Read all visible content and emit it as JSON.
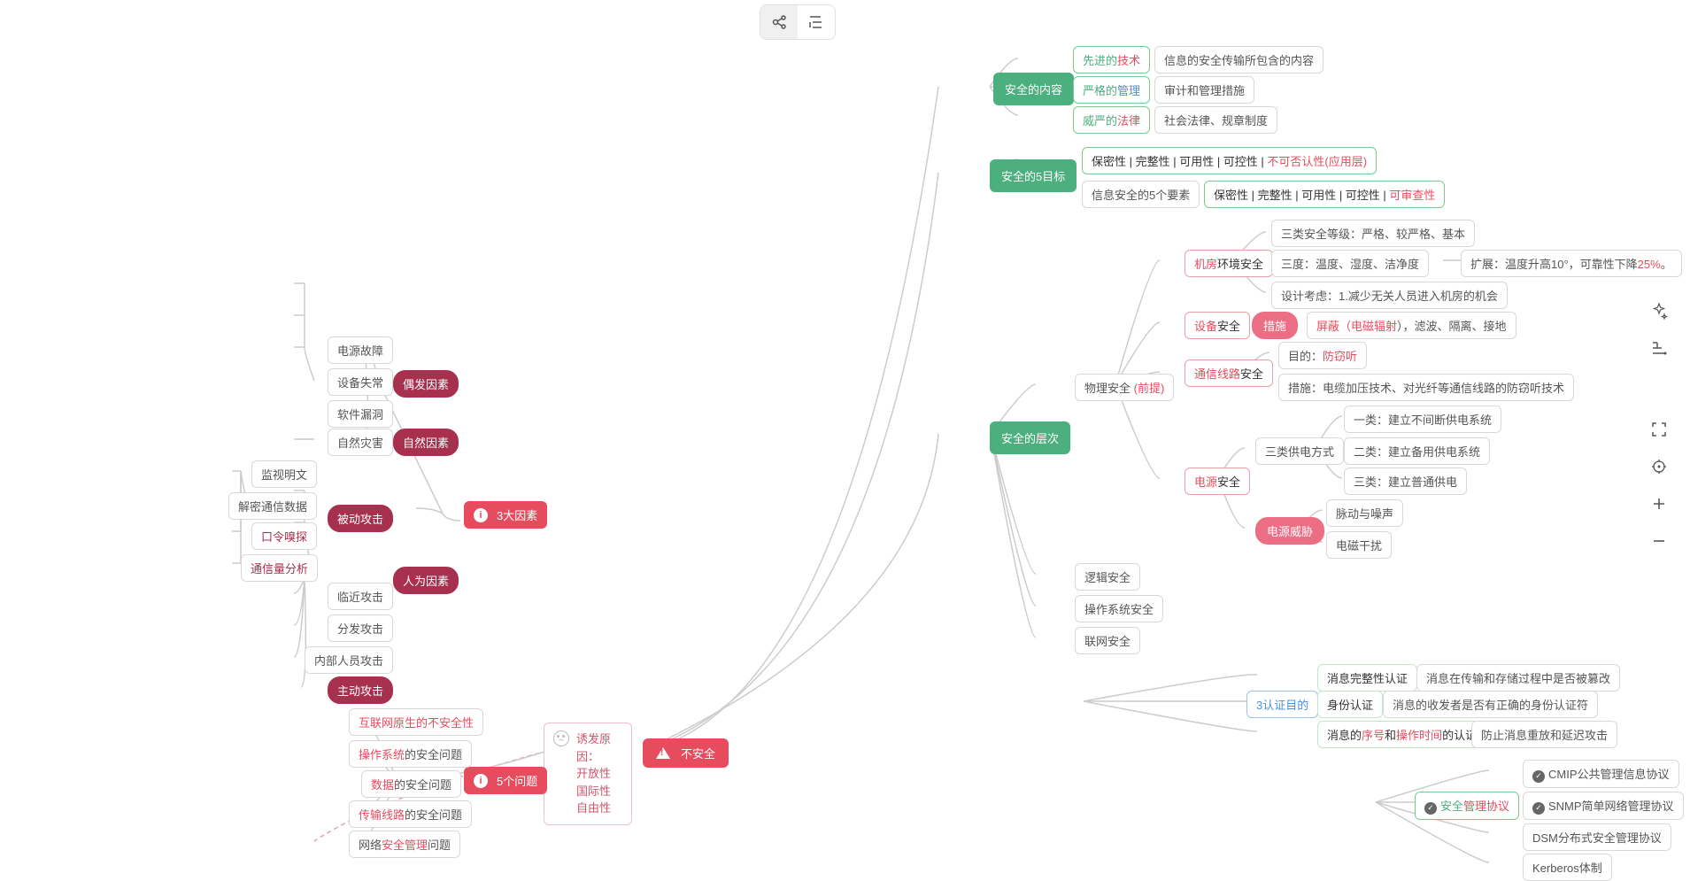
{
  "toolbar": {
    "mindmap_icon": "mindmap-view-icon",
    "outline_icon": "outline-view-icon"
  },
  "right_tools": {
    "magic": "magic-icon",
    "layout": "layout-icon",
    "fit": "fit-view-icon",
    "center": "center-view-icon",
    "zoom_in": "zoom-in-icon",
    "zoom_out": "zoom-out-icon"
  },
  "center": {
    "unsafe": "不安全",
    "cause_box": {
      "title": "诱发原因：",
      "l1": "开放性",
      "l2": "国际性",
      "l3": "自由性"
    }
  },
  "factors3": "3大因素",
  "problems5": "5个问题",
  "accidental": "偶发因素",
  "natural_factor": "自然因素",
  "human_factor": "人为因素",
  "passive_attack": "被动攻击",
  "active_attack": "主动攻击",
  "acc": {
    "power": "电源故障",
    "device": "设备失常",
    "software": "软件漏洞"
  },
  "nat": {
    "disaster": "自然灾害"
  },
  "passive": {
    "monitor": "监视明文",
    "decrypt": "解密通信数据",
    "password": "口令嗅探",
    "traffic": "通信量分析"
  },
  "human": {
    "near": "临近攻击",
    "dist": "分发攻击",
    "internal": "内部人员攻击"
  },
  "problems": {
    "p1a": "互联网原生的",
    "p1b": "不安全性",
    "p2a": "操作系统",
    "p2b": "的安全问题",
    "p3a": "数据",
    "p3b": "的安全问题",
    "p4a": "传输线路",
    "p4b": "的安全问题",
    "p5a": "网络",
    "p5b": "安全管理",
    "p5c": "问题"
  },
  "sec_content": {
    "title": "安全的内容",
    "adv_tech_a": "先进的",
    "adv_tech_b": "技术",
    "adv_tech_desc": "信息的安全传输所包含的内容",
    "strict_mgmt_a": "严格的",
    "strict_mgmt_b": "管理",
    "strict_mgmt_desc": "审计和管理措施",
    "law_a": "威严的",
    "law_b": "法律",
    "law_desc": "社会法律、规章制度"
  },
  "five_targets": {
    "title_a": "安全的",
    "title_b": "5目标",
    "row1": "保密性 | 完整性 | 可用性 | 可控性 | ",
    "row1_red": "不可否认性(应用层)",
    "row2_label": "信息安全的5个要素",
    "row2": "保密性 | 完整性 | 可用性 | 可控性 | ",
    "row2_red": "可审查性"
  },
  "layers": {
    "title": "安全的层次",
    "physical_a": "物理安全 ",
    "physical_b": "(前提)",
    "logical": "逻辑安全",
    "os": "操作系统安全",
    "net": "联网安全"
  },
  "room": {
    "title_a": "机房",
    "title_b": "环境安全",
    "level": "三类安全等级：严格、较严格、基本",
    "three_a": "三度：温度、湿度、洁净度",
    "three_ext_a": "扩展：温度升高10°，可靠性下降",
    "three_ext_b": "25%",
    "three_ext_c": "。",
    "design": "设计考虑：1.减少无关人员进入机房的机会"
  },
  "equip": {
    "title_a": "设备",
    "title_b": "安全",
    "measure": "措施",
    "shield_a": "屏蔽（",
    "shield_b": "电磁辐射",
    "shield_c": "），滤波、隔离、接地"
  },
  "comm": {
    "title_a": "通信线路",
    "title_b": "安全",
    "purpose_a": "目的：",
    "purpose_b": "防窃听",
    "measure": "措施：电缆加压技术、对光纤等通信线路的防窃听技术"
  },
  "power": {
    "title_a": "电源",
    "title_b": "安全",
    "methods": "三类供电方式",
    "m1": "一类：建立不间断供电系统",
    "m2": "二类：建立备用供电系统",
    "m3": "三类：建立普通供电",
    "threat": "电源威胁",
    "t1": "脉动与噪声",
    "t2": "电磁干扰"
  },
  "auth3": {
    "title": "3认证目的",
    "integrity": "消息完整性认证",
    "integrity_desc": "消息在传输和存储过程中是否被篡改",
    "identity": "身份认证",
    "identity_desc": "消息的收发者是否有正确的身份认证符",
    "seq_a": "消息的",
    "seq_b": "序号",
    "seq_c": "和",
    "seq_d": "操作时间",
    "seq_e": "的认证",
    "seq_desc": "防止消息重放和延迟攻击"
  },
  "proto": {
    "title_a": "安全",
    "title_b": "管理协议",
    "p1": "CMIP公共管理信息协议",
    "p2": "SNMP简单网络管理协议",
    "p3": "DSM分布式安全管理协议",
    "p4": "Kerberos体制"
  }
}
